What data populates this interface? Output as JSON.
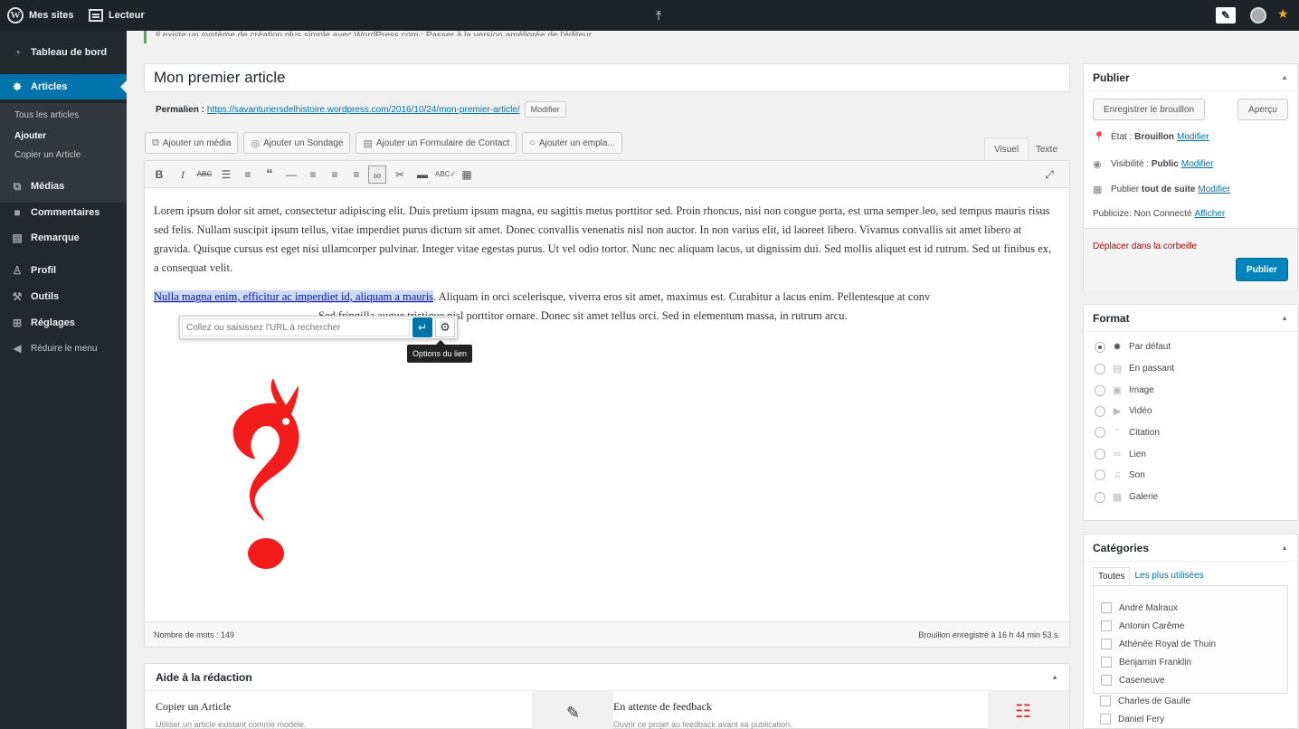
{
  "adminbar": {
    "my_sites": "Mes sites",
    "reader": "Lecteur"
  },
  "sidebar": {
    "dashboard": "Tableau de bord",
    "posts": "Articles",
    "sub_all": "Tous les articles",
    "sub_add": "Ajouter",
    "sub_copy": "Copier un Article",
    "media": "Médias",
    "comments": "Commentaires",
    "feedback": "Remarque",
    "profile": "Profil",
    "tools": "Outils",
    "settings": "Réglages",
    "collapse": "Réduire le menu"
  },
  "notice": {
    "text": "Il existe un système de création plus simple avec WordPress.com : Passer à la version améliorée de l'éditeur."
  },
  "editor": {
    "title": "Mon premier article",
    "permalink_label": "Permalien :",
    "permalink_url": "https://savanturiersdelhistoire.wordpress.com/2016/10/24/mon-premier-article/",
    "permalink_edit": "Modifier",
    "add_media": "Ajouter un média",
    "add_poll": "Ajouter un Sondage",
    "add_form": "Ajouter un Formulaire de Contact",
    "add_location": "Ajouter un empla...",
    "tab_visual": "Visuel",
    "tab_text": "Texte",
    "para1": "Lorem ipsum dolor sit amet, consectetur adipiscing elit. Duis pretium ipsum magna, eu sagittis metus porttitor sed. Proin rhoncus, nisi non congue porta, est urna semper leo, sed tempus mauris risus sed felis. Nullam suscipit ipsum tellus, vitae imperdiet purus dictum sit amet. Donec convallis venenatis nisl non auctor. In non varius elit, id laoreet libero. Vivamus convallis sit amet libero at gravida. Quisque cursus est eget nisi ullamcorper pulvinar. Integer vitae egestas purus. Ut vel odio tortor. Nunc nec aliquam lacus, ut dignissim dui. Sed mollis aliquet est id rutrum. Sed ut finibus ex, a consequat velit.",
    "para2_link": "Nulla magna enim, efficitur ac imperdiet id, aliquam a mauris",
    "para2_rest": ". Aliquam in orci scelerisque, viverra eros sit amet, maximus est. Curabitur a lacus enim. Pellentesque at conv",
    "para2_mid": "Sed fringilla augue tristique nisl porttitor ornare. Donec sit amet tellus orci. Sed in elementum massa, in rutrum",
    "para2_end": "arcu.",
    "link_placeholder": "Collez ou saisissez l'URL à rechercher",
    "link_options_tooltip": "Options du lien",
    "word_count": "Nombre de mots : 149",
    "draft_saved": "Brouillon enregistré à 16 h 44 min 53 s."
  },
  "help": {
    "title": "Aide à la rédaction",
    "col1_title": "Copier un Article",
    "col1_sub": "Utiliser un article existant comme modèle.",
    "col2_title": "En attente de feedback",
    "col2_sub": "Ouvrir ce projet au feedback avant sa publication."
  },
  "publish": {
    "title": "Publier",
    "save_draft": "Enregistrer le brouillon",
    "preview": "Aperçu",
    "status_label": "État :",
    "status_value": "Brouillon",
    "status_edit": "Modifier",
    "visibility_label": "Visibilité :",
    "visibility_value": "Public",
    "visibility_edit": "Modifier",
    "schedule_label": "Publier",
    "schedule_value": "tout de suite",
    "schedule_edit": "Modifier",
    "publicize": "Publicize: Non Connecté",
    "publicize_show": "Afficher",
    "trash": "Déplacer dans la corbeille",
    "publish_button": "Publier"
  },
  "format": {
    "title": "Format",
    "options": [
      "Par défaut",
      "En passant",
      "Image",
      "Vidéo",
      "Citation",
      "Lien",
      "Son",
      "Galerie"
    ]
  },
  "categories": {
    "title": "Catégories",
    "tab_all": "Toutes",
    "tab_popular": "Les plus utilisées",
    "items": [
      "André Malraux",
      "Antonin Carême",
      "Athénée Royal de Thuin",
      "Benjamin Franklin",
      "Caseneuve",
      "Charles de Gaulle",
      "Daniel Fery"
    ]
  },
  "colors": {
    "admin_bar": "#1d2327",
    "sidebar": "#23282d",
    "accent": "#0073aa",
    "publish": "#0085ba",
    "question_mark": "#f31b1b"
  }
}
